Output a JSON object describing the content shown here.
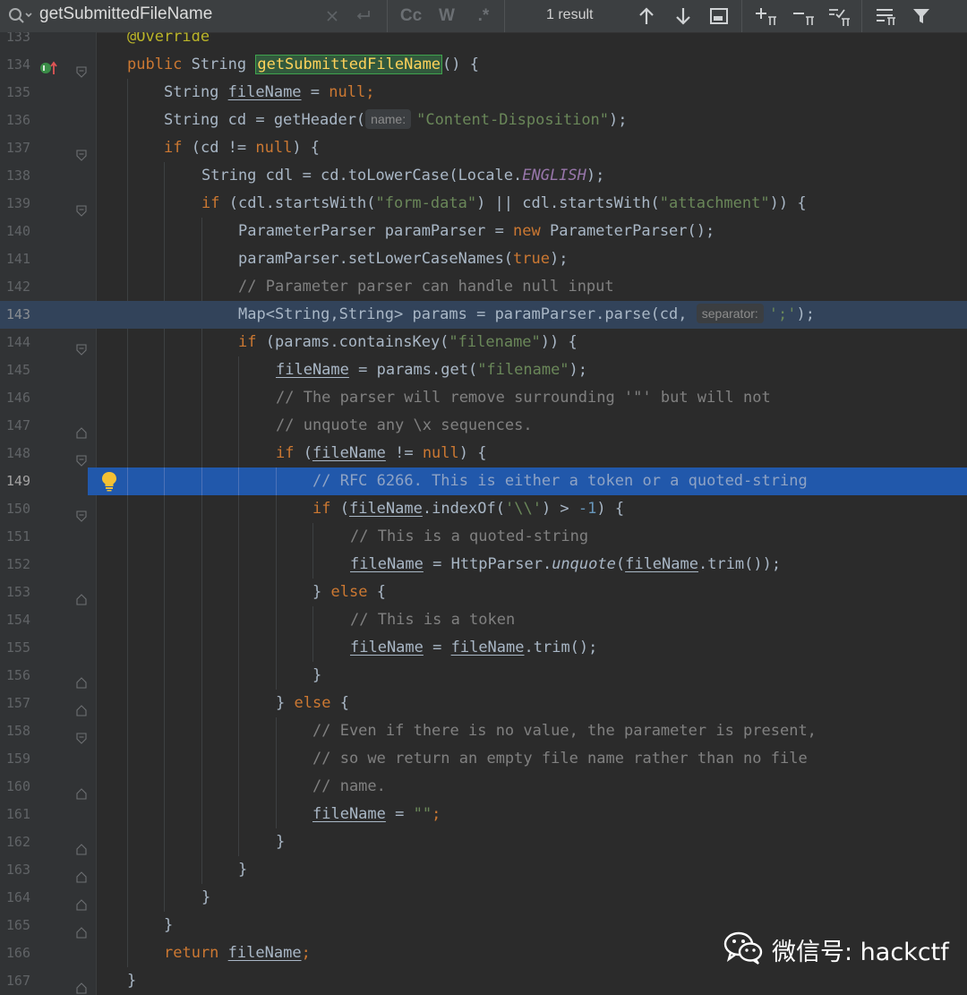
{
  "find_bar": {
    "query": "getSubmittedFileName",
    "match_case_label": "Cc",
    "whole_words_label": "W",
    "regex_label": ".*",
    "result_count": "1 result"
  },
  "code_lines": [
    {
      "n": "133"
    },
    {
      "n": "134"
    },
    {
      "n": "135"
    },
    {
      "n": "136"
    },
    {
      "n": "137"
    },
    {
      "n": "138"
    },
    {
      "n": "139"
    },
    {
      "n": "140"
    },
    {
      "n": "141"
    },
    {
      "n": "142"
    },
    {
      "n": "143"
    },
    {
      "n": "144"
    },
    {
      "n": "145"
    },
    {
      "n": "146"
    },
    {
      "n": "147"
    },
    {
      "n": "148"
    },
    {
      "n": "149"
    },
    {
      "n": "150"
    },
    {
      "n": "151"
    },
    {
      "n": "152"
    },
    {
      "n": "153"
    },
    {
      "n": "154"
    },
    {
      "n": "155"
    },
    {
      "n": "156"
    },
    {
      "n": "157"
    },
    {
      "n": "158"
    },
    {
      "n": "159"
    },
    {
      "n": "160"
    },
    {
      "n": "161"
    },
    {
      "n": "162"
    },
    {
      "n": "163"
    },
    {
      "n": "164"
    },
    {
      "n": "165"
    },
    {
      "n": "166"
    },
    {
      "n": "167"
    }
  ],
  "code": {
    "l133": "@Override",
    "public": "public",
    "string_t": "String",
    "method": "getSubmittedFileName",
    "l134_rest": "() {",
    "l135_a": "String ",
    "fileName": "fileName",
    "eq": " = ",
    "null_kw": "null",
    "semi": ";",
    "l136_a": "String cd = getHeader(",
    "hint_name": "name:",
    "str_cd": "\"Content-Disposition\"",
    "close_semi": ");",
    "if_kw": "if",
    "l137_a": " (cd != ",
    "l137_b": ") {",
    "l138_a": "String cdl = cd.toLowerCase(Locale.",
    "english": "ENGLISH",
    "l139_a": " (cdl.startsWith(",
    "str_formdata": "\"form-data\"",
    "l139_b": ") || cdl.startsWith(",
    "str_attachment": "\"attachment\"",
    "l139_c": ")) {",
    "l140_a": "ParameterParser paramParser = ",
    "new_kw": "new",
    "l140_b": " ParameterParser();",
    "l141_a": "paramParser.setLowerCaseNames(",
    "true_kw": "true",
    "l142": "// Parameter parser can handle null input",
    "l143_a": "Map<String,String> params = paramParser.parse(cd, ",
    "hint_separator": "separator:",
    "str_semicolon": "';'",
    "l144_a": " (params.containsKey(",
    "str_filename": "\"filename\"",
    "l144_b": ")) {",
    "l145_a": " = params.get(",
    "l146": "// The parser will remove surrounding '\"' but will not",
    "l147": "// unquote any \\x sequences.",
    "l148_a": " (",
    "l148_b": " != ",
    "l148_c": ") {",
    "l149": "// RFC 6266. This is either a token or a quoted-string",
    "l150_a": ".indexOf(",
    "str_bs": "'\\\\'",
    "l150_b": ") > ",
    "num_neg1": "-1",
    "l150_c": ") {",
    "l151": "// This is a quoted-string",
    "l152_a": " = HttpParser.",
    "unquote": "unquote",
    "l152_b": "(",
    "trim_call": ".trim());",
    "brace_close": "}",
    "else_kw": "else",
    "brace_open": " {",
    "l154": "// This is a token",
    "trim_semi": ".trim();",
    "l158": "// Even if there is no value, the parameter is present,",
    "l159": "// so we return an empty file name rather than no file",
    "l160": "// name.",
    "str_empty": "\"\"",
    "return_kw": "return",
    "space": " "
  },
  "watermark": {
    "text": "微信号: hackctf",
    "icon": "wechat-icon"
  },
  "colors": {
    "background": "#2b2b2b",
    "keyword": "#cc7832",
    "string": "#6a8759",
    "comment": "#808080",
    "number": "#6897bb",
    "selected_line": "#2158ab",
    "caret_line": "#32435a",
    "search_match": "#32593d"
  }
}
